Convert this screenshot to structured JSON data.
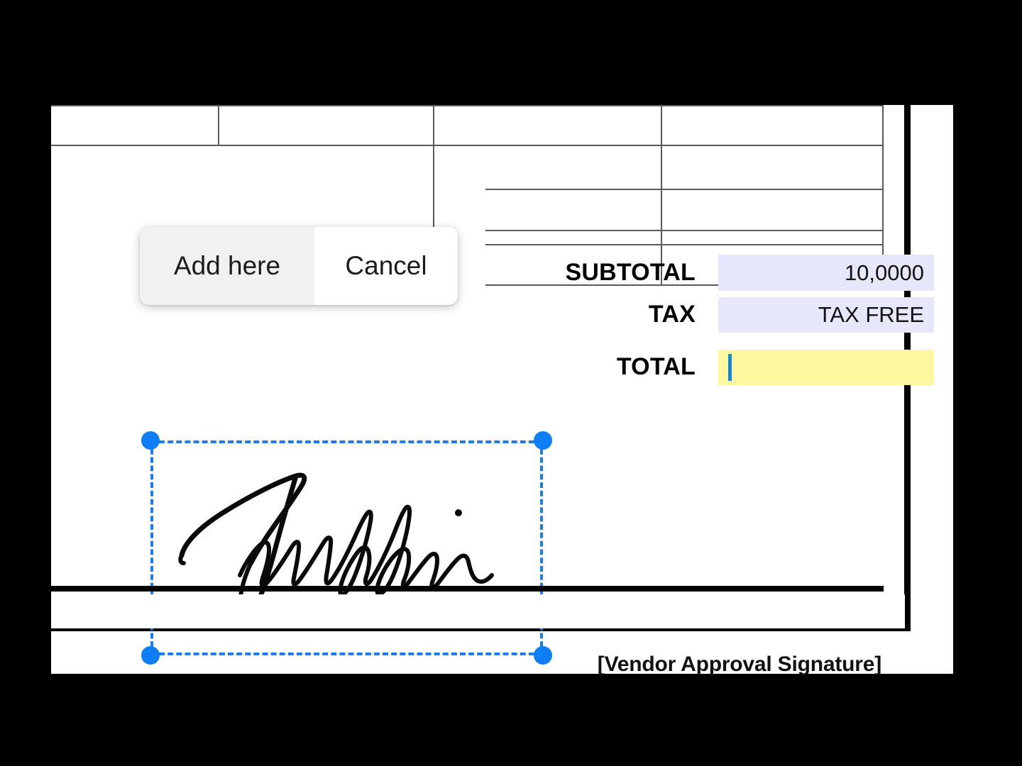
{
  "document": {
    "totals_table": {
      "rows": [
        {
          "label": "SUBTOTAL",
          "value": "10,0000"
        },
        {
          "label": "TAX",
          "value": "TAX FREE"
        },
        {
          "label": "TOTAL",
          "value": ""
        }
      ]
    },
    "signature_caption": "[Vendor Approval Signature]"
  },
  "popup": {
    "add_here_label": "Add here",
    "cancel_label": "Cancel"
  },
  "selection": {
    "handles": [
      "handle-top-left",
      "handle-top-right",
      "handle-bottom-left",
      "handle-bottom-right"
    ],
    "content": "handwritten-signature"
  },
  "colors": {
    "selection_blue": "#0d7ef5",
    "highlight_lavender": "#e7e7fb",
    "active_field_yellow": "#fbf8a0",
    "caret_blue": "#1787d8",
    "popup_selected_grey": "#f1f1f1",
    "page_black": "#000000"
  }
}
